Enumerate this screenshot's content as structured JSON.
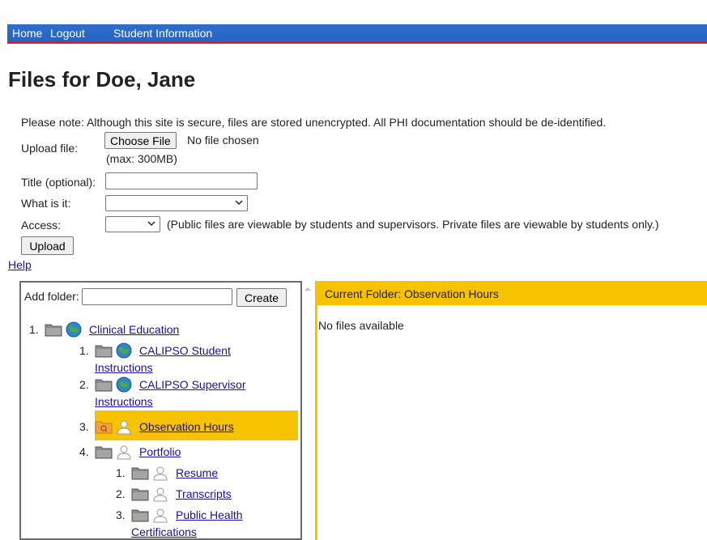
{
  "nav": {
    "home": "Home",
    "logout": "Logout",
    "student_info": "Student Information"
  },
  "page_title": "Files for Doe, Jane",
  "note": "Please note: Although this site is secure, files are stored unencrypted. All PHI documentation should be de-identified.",
  "upload": {
    "label": "Upload file:",
    "choose_button": "Choose File",
    "no_file": "No file chosen",
    "max": "(max: 300MB)",
    "title_label": "Title (optional):",
    "title_value": "",
    "what_label": "What is it:",
    "what_value": "",
    "access_label": "Access:",
    "access_value": "",
    "access_note": "(Public files are viewable by students and supervisors. Private files are viewable by students only.)",
    "upload_button": "Upload"
  },
  "help": "Help",
  "folders": {
    "add_label": "Add folder:",
    "add_value": "",
    "create_button": "Create",
    "current_folder": "Current Folder: Observation Hours",
    "no_files": "No files available",
    "tree": [
      {
        "num": "1.",
        "name": "Clinical Education",
        "badge": "globe-icon"
      },
      {
        "num": "1.",
        "name": "CALIPSO Student",
        "name2": "Instructions",
        "badge": "globe-icon"
      },
      {
        "num": "2.",
        "name": "CALIPSO Supervisor",
        "name2": "Instructions",
        "badge": "globe-icon"
      },
      {
        "num": "3.",
        "name": "Observation Hours",
        "badge": "user-icon",
        "selected": true
      },
      {
        "num": "4.",
        "name": "Portfolio",
        "badge": "user-icon"
      },
      {
        "num": "1.",
        "name": "Resume",
        "badge": "user-icon"
      },
      {
        "num": "2.",
        "name": "Transcripts",
        "badge": "user-icon"
      },
      {
        "num": "3.",
        "name": "Public Health",
        "name2": "Certifications",
        "badge": "user-icon"
      }
    ]
  },
  "colors": {
    "nav_blue": "#2563c2",
    "nav_red": "#d71920",
    "highlight": "#f7c200",
    "link": "#1a0dab"
  }
}
